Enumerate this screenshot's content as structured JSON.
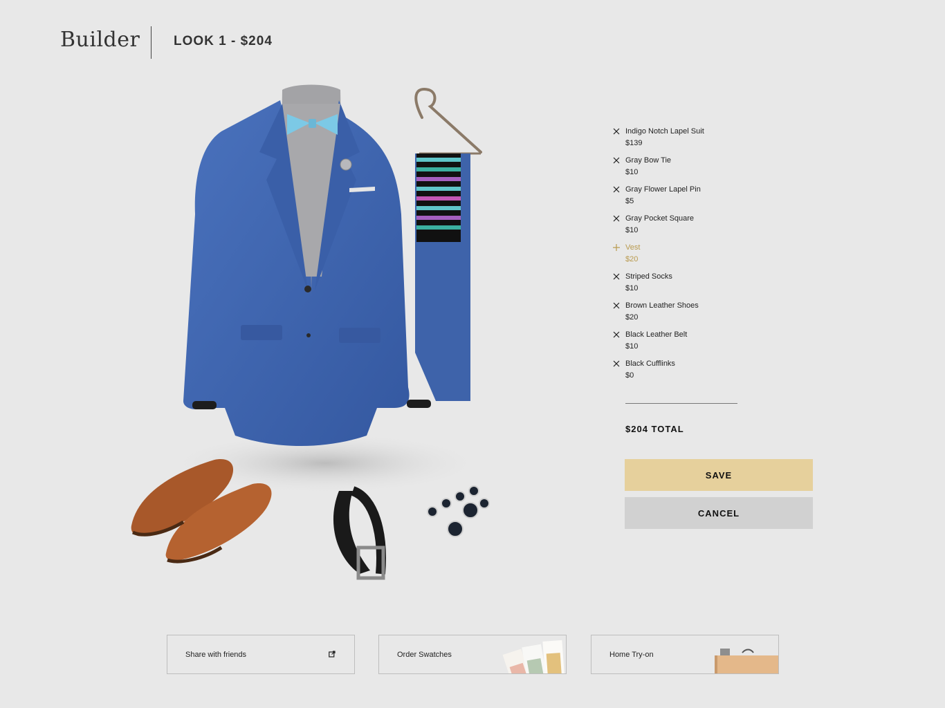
{
  "header": {
    "brand": "Builder",
    "look_title": "LOOK 1 - $204"
  },
  "items": [
    {
      "name": "Indigo Notch Lapel Suit",
      "price": "$139",
      "state": "remove",
      "icon": "close-icon"
    },
    {
      "name": "Gray Bow Tie",
      "price": "$10",
      "state": "remove",
      "icon": "close-icon"
    },
    {
      "name": "Gray Flower Lapel Pin",
      "price": "$5",
      "state": "remove",
      "icon": "close-icon"
    },
    {
      "name": "Gray Pocket Square",
      "price": "$10",
      "state": "remove",
      "icon": "close-icon"
    },
    {
      "name": "Vest",
      "price": "$20",
      "state": "add",
      "icon": "plus-icon"
    },
    {
      "name": "Striped Socks",
      "price": "$10",
      "state": "remove",
      "icon": "close-icon"
    },
    {
      "name": "Brown Leather Shoes",
      "price": "$20",
      "state": "remove",
      "icon": "close-icon"
    },
    {
      "name": "Black Leather Belt",
      "price": "$10",
      "state": "remove",
      "icon": "close-icon"
    },
    {
      "name": "Black Cufflinks",
      "price": "$0",
      "state": "remove",
      "icon": "close-icon"
    }
  ],
  "summary": {
    "total": "$204 TOTAL"
  },
  "actions": {
    "save_label": "SAVE",
    "cancel_label": "CANCEL"
  },
  "cards": {
    "share": "Share with friends",
    "swatches": "Order Swatches",
    "tryon": "Home Try-on"
  },
  "colors": {
    "background": "#e8e8e8",
    "save_button": "#e6d09c",
    "cancel_button": "#d1d1d1",
    "optional_item": "#b99a4e",
    "suit_blue": "#3f66b0"
  }
}
